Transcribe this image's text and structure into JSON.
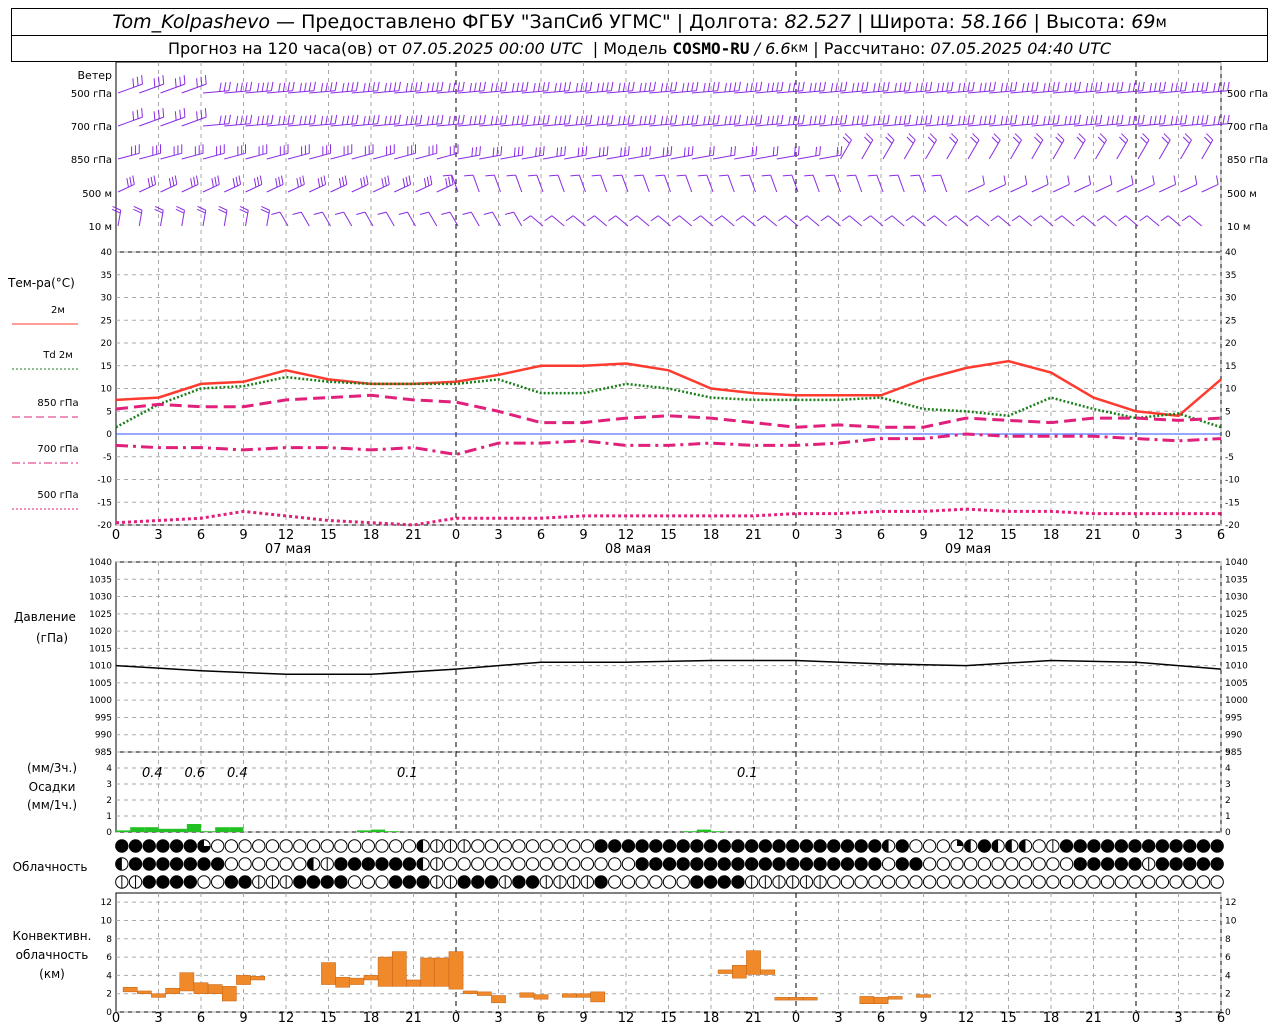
{
  "header": {
    "station": "Tom_Kolpashevo",
    "dash": " — ",
    "provider": "Предоставлено ФГБУ \"ЗапСиб УГМС\"",
    "sep": " | ",
    "lon_label": "Долгота: ",
    "lon": "82.527",
    "lat_label": "Широта: ",
    "lat": "58.166",
    "alt_label": "Высота: ",
    "alt": "69",
    "alt_unit": "м",
    "forecast_label": "Прогноз на 120 часа(ов) от ",
    "forecast_time": "07.05.2025 00:00 UTC",
    "model_label": "  | Модель ",
    "model": "COSMO-RU",
    "model_res": " / 6.6",
    "model_res_unit": "км",
    "calc_label": " | Рассчитано: ",
    "calc_time": "07.05.2025 04:40 UTC"
  },
  "wind_panel": {
    "title": "Ветер",
    "levels": [
      "500 гПа",
      "700 гПа",
      "850 гПа",
      "500 м",
      "10  м"
    ],
    "color": "#8a2be2"
  },
  "temp_panel": {
    "title": "Тем-ра(°C)",
    "legend": [
      {
        "label": "2м",
        "color": "#ff3b30",
        "style": "solid"
      },
      {
        "label": "Td  2м",
        "color": "#1a7f1a",
        "style": "dotted"
      },
      {
        "label": "850 гПа",
        "color": "#e0207a",
        "style": "dashed"
      },
      {
        "label": "700 гПа",
        "color": "#e0207a",
        "style": "dashdot"
      },
      {
        "label": "500 гПа",
        "color": "#e0207a",
        "style": "dotted"
      }
    ],
    "yticks": [
      "40",
      "35",
      "30",
      "25",
      "20",
      "15",
      "10",
      "5",
      "0",
      "-5",
      "-10",
      "-15",
      "-20"
    ]
  },
  "xaxis": {
    "ticks": [
      "0",
      "3",
      "6",
      "9",
      "12",
      "15",
      "18",
      "21",
      "0",
      "3",
      "6",
      "9",
      "12",
      "15",
      "18",
      "21",
      "0",
      "3",
      "6",
      "9",
      "12",
      "15",
      "18",
      "21",
      "0",
      "3",
      "6"
    ],
    "dates": [
      "07 мая",
      "08 мая",
      "09 мая"
    ]
  },
  "pressure_panel": {
    "title1": "Давление",
    "title2": "(гПа)",
    "yticks": [
      "1040",
      "1035",
      "1030",
      "1025",
      "1020",
      "1015",
      "1010",
      "1005",
      "1000",
      "995",
      "990",
      "985"
    ]
  },
  "precip_panel": {
    "title1": "(мм/3ч.)",
    "title2": "Осадки",
    "title3": "(мм/1ч.)",
    "yticks": [
      "5",
      "4",
      "3",
      "2",
      "1",
      "0"
    ],
    "annotations": [
      {
        "text": "0.4",
        "hour": 2
      },
      {
        "text": "0.6",
        "hour": 5
      },
      {
        "text": "0.4",
        "hour": 8
      },
      {
        "text": "0.1",
        "hour": 20
      },
      {
        "text": "0.1",
        "hour": 44
      }
    ]
  },
  "cloud_panel": {
    "title": "Облачность"
  },
  "conv_panel": {
    "title1": "Конвективн.",
    "title2": "облачность",
    "title3": "(км)",
    "yticks": [
      "12",
      "10",
      "8",
      "6",
      "4",
      "2",
      "0"
    ]
  },
  "chart_data": [
    {
      "type": "line",
      "title": "Тем-ра(°C)",
      "x_hours": [
        0,
        3,
        6,
        9,
        12,
        15,
        18,
        21,
        24,
        27,
        30,
        33,
        36,
        39,
        42,
        45,
        48,
        51,
        54,
        57,
        60,
        63,
        66,
        69,
        72,
        75,
        78
      ],
      "ylim": [
        -20,
        40
      ],
      "series": [
        {
          "name": "2м",
          "values": [
            7.5,
            8,
            11,
            11.5,
            14,
            12,
            11,
            11,
            11.5,
            13,
            15,
            15,
            15.5,
            14,
            10,
            9,
            8.5,
            8.5,
            8.5,
            12,
            14.5,
            16,
            13.5,
            8,
            5,
            4,
            12
          ]
        },
        {
          "name": "Td  2м",
          "values": [
            1.5,
            6.5,
            10,
            10.5,
            12.5,
            11.5,
            11,
            11,
            11,
            12,
            9,
            9,
            11,
            10,
            8,
            7.5,
            7.5,
            7.5,
            8,
            5.5,
            5,
            4,
            8,
            5.5,
            3.5,
            4.5,
            1.5
          ]
        },
        {
          "name": "850 гПа",
          "values": [
            5.5,
            6.5,
            6,
            6,
            7.5,
            8,
            8.5,
            7.5,
            7,
            5,
            2.5,
            2.5,
            3.5,
            4,
            3.5,
            2.5,
            1.5,
            2,
            1.5,
            1.5,
            3.5,
            3,
            2.5,
            3.5,
            3.5,
            3,
            3.5
          ]
        },
        {
          "name": "700 гПа",
          "values": [
            -2.5,
            -3,
            -3,
            -3.5,
            -3,
            -3,
            -3.5,
            -3,
            -4.5,
            -2,
            -2,
            -1.5,
            -2.5,
            -2.5,
            -2,
            -2.5,
            -2.5,
            -2,
            -1,
            -1,
            0,
            -0.5,
            -0.5,
            -0.5,
            -1,
            -1.5,
            -1
          ]
        },
        {
          "name": "500 гПа",
          "values": [
            -19.5,
            -19,
            -18.5,
            -17,
            -18,
            -19,
            -19.5,
            -20,
            -18.5,
            -18.5,
            -18.5,
            -18,
            -18,
            -18,
            -18,
            -18,
            -17.5,
            -17.5,
            -17,
            -17,
            -16.5,
            -17,
            -17,
            -17.5,
            -17.5,
            -17.5,
            -17.5
          ]
        }
      ]
    },
    {
      "type": "line",
      "title": "Давление",
      "x_hours": [
        0,
        6,
        12,
        18,
        24,
        30,
        36,
        42,
        48,
        54,
        60,
        66,
        72,
        78
      ],
      "ylim": [
        985,
        1040
      ],
      "series": [
        {
          "values": [
            1010,
            1008.5,
            1007.5,
            1007.5,
            1009,
            1011,
            1011,
            1011.5,
            1011.5,
            1010.5,
            1010,
            1011.5,
            1011,
            1009
          ]
        }
      ]
    },
    {
      "type": "bar",
      "title": "Осадки",
      "ylim": [
        0,
        5
      ],
      "x_hours": [
        1,
        2,
        3,
        4,
        5,
        6,
        7,
        8,
        9,
        18,
        19,
        20,
        41,
        42,
        43
      ],
      "values": [
        0.1,
        0.3,
        0.3,
        0.2,
        0.2,
        0.5,
        0.05,
        0.3,
        0.3,
        0.1,
        0.15,
        0.05,
        0.05,
        0.15,
        0.05
      ]
    },
    {
      "type": "bar",
      "title": "Конвективн. облачность (км)",
      "ylim": [
        0,
        13
      ],
      "bars": [
        {
          "x": 1,
          "base": 2.2,
          "top": 2.7
        },
        {
          "x": 2,
          "base": 2,
          "top": 2.3
        },
        {
          "x": 3,
          "base": 1.6,
          "top": 2
        },
        {
          "x": 4,
          "base": 2,
          "top": 2.6
        },
        {
          "x": 5,
          "base": 2.3,
          "top": 4.3
        },
        {
          "x": 6,
          "base": 2,
          "top": 3.2
        },
        {
          "x": 7,
          "base": 2,
          "top": 3
        },
        {
          "x": 8,
          "base": 1.2,
          "top": 2.8
        },
        {
          "x": 9,
          "base": 3,
          "top": 4
        },
        {
          "x": 10,
          "base": 3.5,
          "top": 3.9
        },
        {
          "x": 15,
          "base": 3,
          "top": 5.4
        },
        {
          "x": 16,
          "base": 2.7,
          "top": 3.8
        },
        {
          "x": 17,
          "base": 3,
          "top": 3.7
        },
        {
          "x": 18,
          "base": 3.5,
          "top": 4
        },
        {
          "x": 19,
          "base": 2.8,
          "top": 6
        },
        {
          "x": 20,
          "base": 2.8,
          "top": 6.6
        },
        {
          "x": 21,
          "base": 2.8,
          "top": 3.5
        },
        {
          "x": 22,
          "base": 2.8,
          "top": 5.9
        },
        {
          "x": 23,
          "base": 2.8,
          "top": 5.9
        },
        {
          "x": 24,
          "base": 2.5,
          "top": 6.6
        },
        {
          "x": 25,
          "base": 2,
          "top": 2.3
        },
        {
          "x": 26,
          "base": 1.8,
          "top": 2.2
        },
        {
          "x": 27,
          "base": 1,
          "top": 1.8
        },
        {
          "x": 29,
          "base": 1.6,
          "top": 2.1
        },
        {
          "x": 30,
          "base": 1.4,
          "top": 1.9
        },
        {
          "x": 32,
          "base": 1.6,
          "top": 2
        },
        {
          "x": 33,
          "base": 1.6,
          "top": 2
        },
        {
          "x": 34,
          "base": 1.1,
          "top": 2.2
        },
        {
          "x": 43,
          "base": 4.2,
          "top": 4.6
        },
        {
          "x": 44,
          "base": 3.7,
          "top": 5.1
        },
        {
          "x": 45,
          "base": 4.1,
          "top": 6.7
        },
        {
          "x": 46,
          "base": 4.1,
          "top": 4.6
        },
        {
          "x": 47,
          "base": 1.3,
          "top": 1.6
        },
        {
          "x": 48,
          "base": 1.3,
          "top": 1.6
        },
        {
          "x": 49,
          "base": 1.3,
          "top": 1.6
        },
        {
          "x": 53,
          "base": 0.9,
          "top": 1.7
        },
        {
          "x": 54,
          "base": 0.9,
          "top": 1.6
        },
        {
          "x": 55,
          "base": 1.4,
          "top": 1.7
        },
        {
          "x": 57,
          "base": 1.6,
          "top": 1.9
        }
      ]
    }
  ]
}
